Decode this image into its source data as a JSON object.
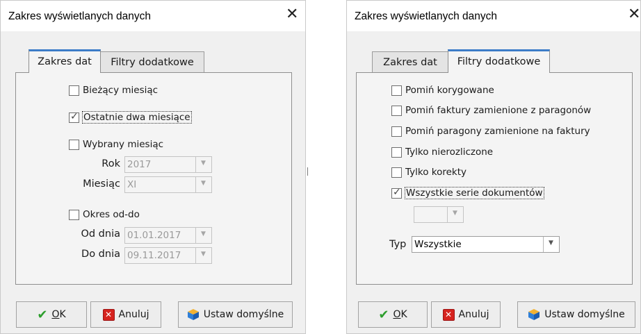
{
  "left": {
    "title": "Zakres wyświetlanych danych",
    "close": "✕",
    "tabs": [
      {
        "label": "Zakres dat"
      },
      {
        "label": "Filtry dodatkowe"
      }
    ],
    "options": [
      {
        "label": "Bieżący miesiąc",
        "checked": false
      },
      {
        "label": "Ostatnie dwa miesiące",
        "checked": true
      },
      {
        "label": "Wybrany miesiąc",
        "checked": false
      },
      {
        "label": "Okres od-do",
        "checked": false
      }
    ],
    "rok_label": "Rok",
    "rok_value": "2017",
    "miesiac_label": "Miesiąc",
    "miesiac_value": "XI",
    "od_label": "Od dnia",
    "od_value": "01.01.2017",
    "do_label": "Do dnia",
    "do_value": "09.11.2017",
    "buttons": {
      "ok": "OK",
      "ok_mnemonic": "O",
      "ok_rest": "K",
      "cancel": "Anuluj",
      "defaults": "Ustaw domyślne"
    }
  },
  "right": {
    "title": "Zakres wyświetlanych danych",
    "close": "✕",
    "tabs": [
      {
        "label": "Zakres dat"
      },
      {
        "label": "Filtry dodatkowe"
      }
    ],
    "options": [
      {
        "label": "Pomiń korygowane",
        "checked": false
      },
      {
        "label": "Pomiń faktury zamienione z paragonów",
        "checked": false
      },
      {
        "label": "Pomiń paragony zamienione na faktury",
        "checked": false
      },
      {
        "label": "Tylko nierozliczone",
        "checked": false
      },
      {
        "label": "Tylko korekty",
        "checked": false
      },
      {
        "label": "Wszystkie serie dokumentów",
        "checked": true
      }
    ],
    "series_value": "",
    "typ_label": "Typ",
    "typ_value": "Wszystkie",
    "buttons": {
      "ok_mnemonic": "O",
      "ok_rest": "K",
      "cancel": "Anuluj",
      "defaults": "Ustaw domyślne"
    }
  },
  "icons": {
    "ok": "checkmark-icon",
    "cancel": "red-x-icon",
    "defaults": "cube-icon",
    "dropdown": "chevron-down-icon"
  }
}
